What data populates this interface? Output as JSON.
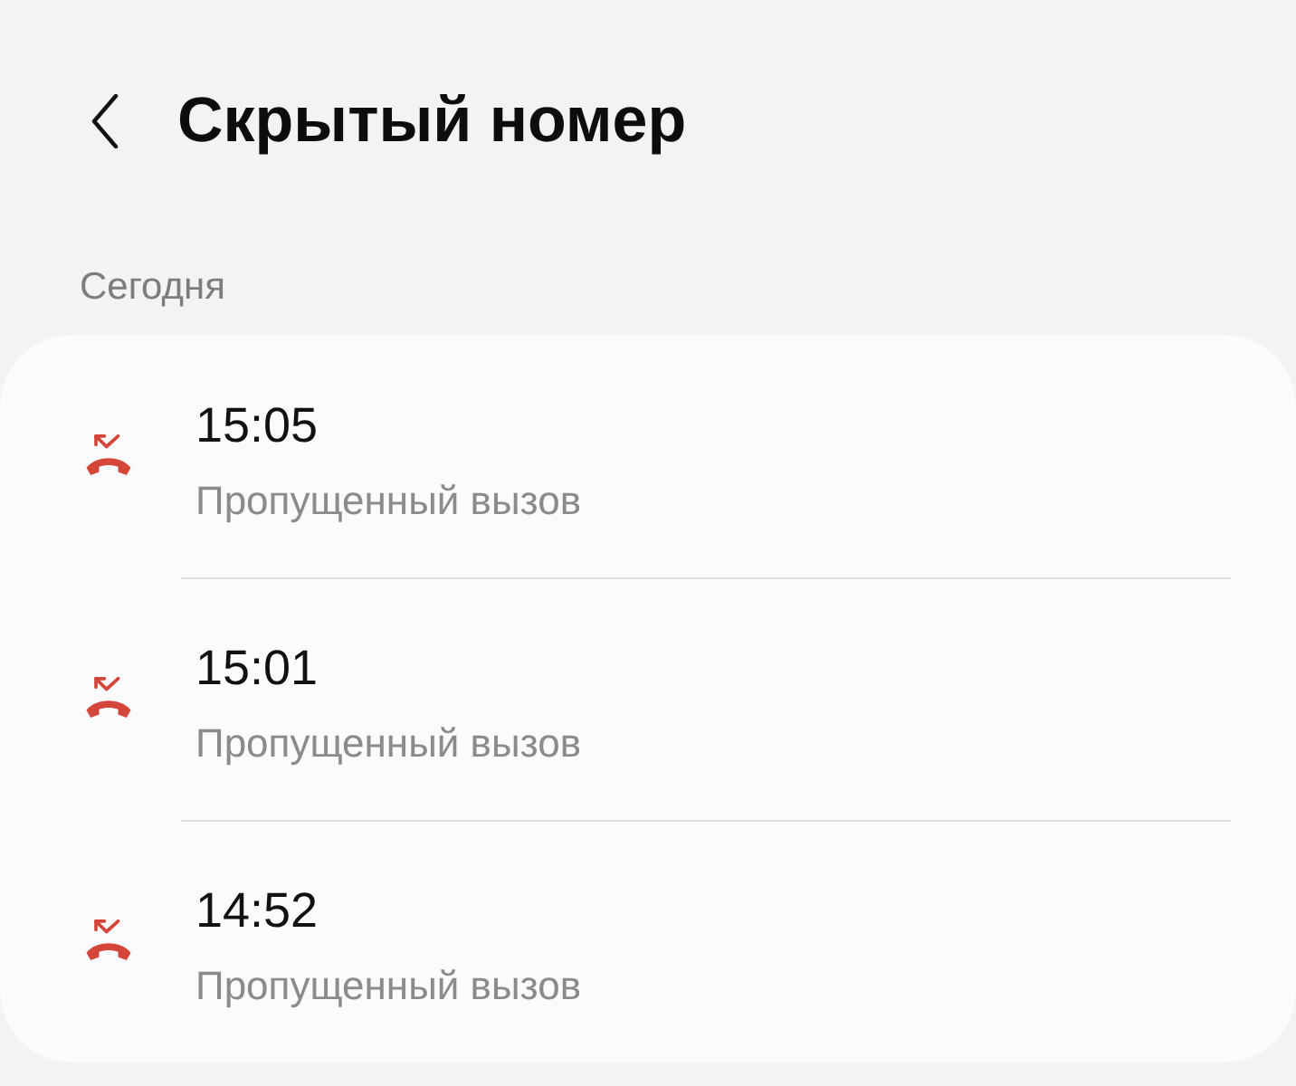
{
  "header": {
    "title": "Скрытый номер"
  },
  "section": {
    "label": "Сегодня"
  },
  "calls": [
    {
      "kind": "missed",
      "time": "15:05",
      "status": "Пропущенный вызов"
    },
    {
      "kind": "missed",
      "time": "15:01",
      "status": "Пропущенный вызов"
    },
    {
      "kind": "missed",
      "time": "14:52",
      "status": "Пропущенный вызов"
    }
  ]
}
